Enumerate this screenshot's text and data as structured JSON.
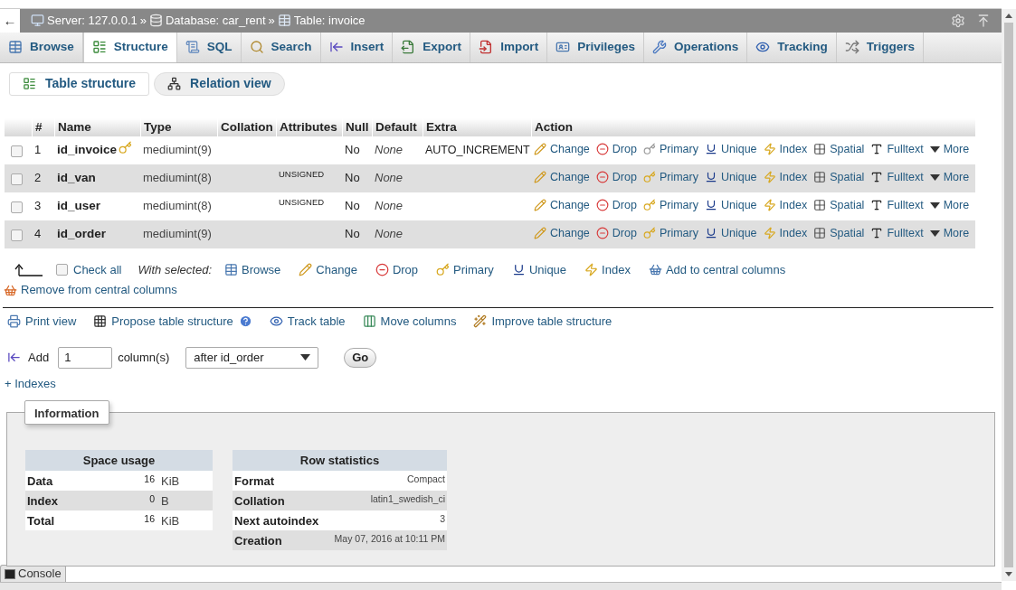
{
  "back": "←",
  "breadcrumb": [
    {
      "kind": "server",
      "label": "Server: 127.0.0.1",
      "separator": "»"
    },
    {
      "kind": "database",
      "label": "Database: car_rent",
      "separator": "»"
    },
    {
      "kind": "table",
      "label": "Table: invoice"
    }
  ],
  "tabs": [
    {
      "kind": "browse",
      "label": "Browse",
      "selected": false
    },
    {
      "kind": "structure",
      "label": "Structure",
      "selected": true
    },
    {
      "kind": "sql",
      "label": "SQL",
      "selected": false
    },
    {
      "kind": "search",
      "label": "Search",
      "selected": false
    },
    {
      "kind": "insert",
      "label": "Insert",
      "selected": false
    },
    {
      "kind": "export",
      "label": "Export",
      "selected": false
    },
    {
      "kind": "import",
      "label": "Import",
      "selected": false
    },
    {
      "kind": "privileges",
      "label": "Privileges",
      "selected": false
    },
    {
      "kind": "operations",
      "label": "Operations",
      "selected": false
    },
    {
      "kind": "tracking",
      "label": "Tracking",
      "selected": false
    },
    {
      "kind": "triggers",
      "label": "Triggers",
      "selected": false
    }
  ],
  "subtabs": [
    {
      "kind": "structure",
      "label": "Table structure",
      "selected": true
    },
    {
      "kind": "relation",
      "label": "Relation view",
      "selected": false
    }
  ],
  "table": {
    "columns": [
      "#",
      "Name",
      "Type",
      "Collation",
      "Attributes",
      "Null",
      "Default",
      "Extra",
      "Action"
    ],
    "rows": [
      {
        "checked": false,
        "number": "1",
        "name": "id_invoice",
        "primary_key": true,
        "type": "mediumint(9)",
        "null": "No",
        "default": "None",
        "extra": "AUTO_INCREMENT",
        "actions": [
          {
            "kind": "change",
            "label": "Change"
          },
          {
            "kind": "drop",
            "label": "Drop"
          },
          {
            "kind": "primary",
            "label": "Primary"
          },
          {
            "kind": "unique",
            "label": "Unique"
          },
          {
            "kind": "index",
            "label": "Index"
          },
          {
            "kind": "spatial",
            "label": "Spatial"
          },
          {
            "kind": "fulltext",
            "label": "Fulltext"
          },
          {
            "kind": "more",
            "label": "More"
          }
        ]
      },
      {
        "checked": false,
        "number": "2",
        "name": "id_van",
        "primary_key": false,
        "type": "mediumint(8)",
        "attributes": "UNSIGNED",
        "null": "No",
        "default": "None",
        "actions": [
          {
            "kind": "change",
            "label": "Change"
          },
          {
            "kind": "drop",
            "label": "Drop"
          },
          {
            "kind": "primary",
            "label": "Primary"
          },
          {
            "kind": "unique",
            "label": "Unique"
          },
          {
            "kind": "index",
            "label": "Index"
          },
          {
            "kind": "spatial",
            "label": "Spatial"
          },
          {
            "kind": "fulltext",
            "label": "Fulltext"
          },
          {
            "kind": "more",
            "label": "More"
          }
        ]
      },
      {
        "checked": false,
        "number": "3",
        "name": "id_user",
        "primary_key": false,
        "type": "mediumint(8)",
        "attributes": "UNSIGNED",
        "null": "No",
        "default": "None",
        "actions": [
          {
            "kind": "change",
            "label": "Change"
          },
          {
            "kind": "drop",
            "label": "Drop"
          },
          {
            "kind": "primary",
            "label": "Primary"
          },
          {
            "kind": "unique",
            "label": "Unique"
          },
          {
            "kind": "index",
            "label": "Index"
          },
          {
            "kind": "spatial",
            "label": "Spatial"
          },
          {
            "kind": "fulltext",
            "label": "Fulltext"
          },
          {
            "kind": "more",
            "label": "More"
          }
        ]
      },
      {
        "checked": false,
        "number": "4",
        "name": "id_order",
        "primary_key": false,
        "type": "mediumint(9)",
        "null": "No",
        "default": "None",
        "actions": [
          {
            "kind": "change",
            "label": "Change"
          },
          {
            "kind": "drop",
            "label": "Drop"
          },
          {
            "kind": "primary",
            "label": "Primary"
          },
          {
            "kind": "unique",
            "label": "Unique"
          },
          {
            "kind": "index",
            "label": "Index"
          },
          {
            "kind": "spatial",
            "label": "Spatial"
          },
          {
            "kind": "fulltext",
            "label": "Fulltext"
          },
          {
            "kind": "more",
            "label": "More"
          }
        ]
      }
    ]
  },
  "with_selected": {
    "check_all": {
      "label": "Check all",
      "checked": false
    },
    "label": "With selected:",
    "actions": [
      {
        "kind": "browse",
        "label": "Browse"
      },
      {
        "kind": "change",
        "label": "Change"
      },
      {
        "kind": "drop",
        "label": "Drop"
      },
      {
        "kind": "primary",
        "label": "Primary"
      },
      {
        "kind": "unique",
        "label": "Unique"
      },
      {
        "kind": "index",
        "label": "Index"
      },
      {
        "kind": "add_central",
        "label": "Add to central columns"
      },
      {
        "kind": "remove_central",
        "label": "Remove from central columns"
      }
    ]
  },
  "tools": [
    {
      "kind": "print",
      "label": "Print view",
      "help": false
    },
    {
      "kind": "propose",
      "label": "Propose table structure",
      "help": true
    },
    {
      "kind": "track",
      "label": "Track table",
      "help": false
    },
    {
      "kind": "move",
      "label": "Move columns",
      "help": false
    },
    {
      "kind": "improve",
      "label": "Improve table structure",
      "help": false
    }
  ],
  "add_column": {
    "label": "Add",
    "count": "1",
    "unit": "column(s)",
    "position": "after id_order",
    "button": "Go"
  },
  "indexes": {
    "toggle": "+",
    "label": "Indexes"
  },
  "information": {
    "legend": "Information",
    "space_usage": {
      "title": "Space usage",
      "rows": [
        {
          "label": "Data",
          "value": "16",
          "unit": "KiB"
        },
        {
          "label": "Index",
          "value": "0",
          "unit": "B"
        },
        {
          "label": "Total",
          "value": "16",
          "unit": "KiB"
        }
      ]
    },
    "row_statistics": {
      "title": "Row statistics",
      "rows": [
        {
          "label": "Format",
          "value": "Compact"
        },
        {
          "label": "Collation",
          "value": "latin1_swedish_ci"
        },
        {
          "label": "Next autoindex",
          "value": "3"
        },
        {
          "label": "Creation",
          "value": "May 07, 2016 at 10:11 PM"
        }
      ]
    }
  },
  "console": "Console"
}
